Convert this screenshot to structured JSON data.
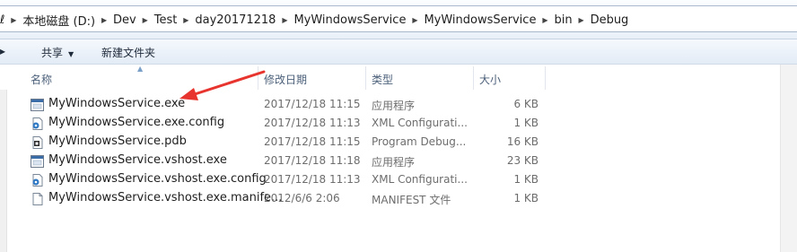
{
  "breadcrumb": [
    "本地磁盘 (D:)",
    "Dev",
    "Test",
    "day20171218",
    "MyWindowsService",
    "MyWindowsService",
    "bin",
    "Debug"
  ],
  "breadcrumb_edge": "ℓ",
  "toolbar": {
    "share_label": "共享",
    "new_folder_label": "新建文件夹"
  },
  "columns": {
    "name": "名称",
    "date": "修改日期",
    "type": "类型",
    "size": "大小"
  },
  "files": [
    {
      "name": "MyWindowsService.exe",
      "date": "2017/12/18 11:15",
      "type": "应用程序",
      "size": "6 KB",
      "icon": "exe-icon"
    },
    {
      "name": "MyWindowsService.exe.config",
      "date": "2017/12/18 11:13",
      "type": "XML Configurati...",
      "size": "1 KB",
      "icon": "config-icon"
    },
    {
      "name": "MyWindowsService.pdb",
      "date": "2017/12/18 11:15",
      "type": "Program Debug...",
      "size": "16 KB",
      "icon": "pdb-icon"
    },
    {
      "name": "MyWindowsService.vshost.exe",
      "date": "2017/12/18 11:18",
      "type": "应用程序",
      "size": "23 KB",
      "icon": "exe-icon"
    },
    {
      "name": "MyWindowsService.vshost.exe.config",
      "date": "2017/12/18 11:13",
      "type": "XML Configurati...",
      "size": "1 KB",
      "icon": "config-icon"
    },
    {
      "name": "MyWindowsService.vshost.exe.manife...",
      "date": "2012/6/6 2:06",
      "type": "MANIFEST 文件",
      "size": "1 KB",
      "icon": "file-icon"
    }
  ],
  "annotation": {
    "color": "#e8342e",
    "target": "MyWindowsService.exe"
  }
}
